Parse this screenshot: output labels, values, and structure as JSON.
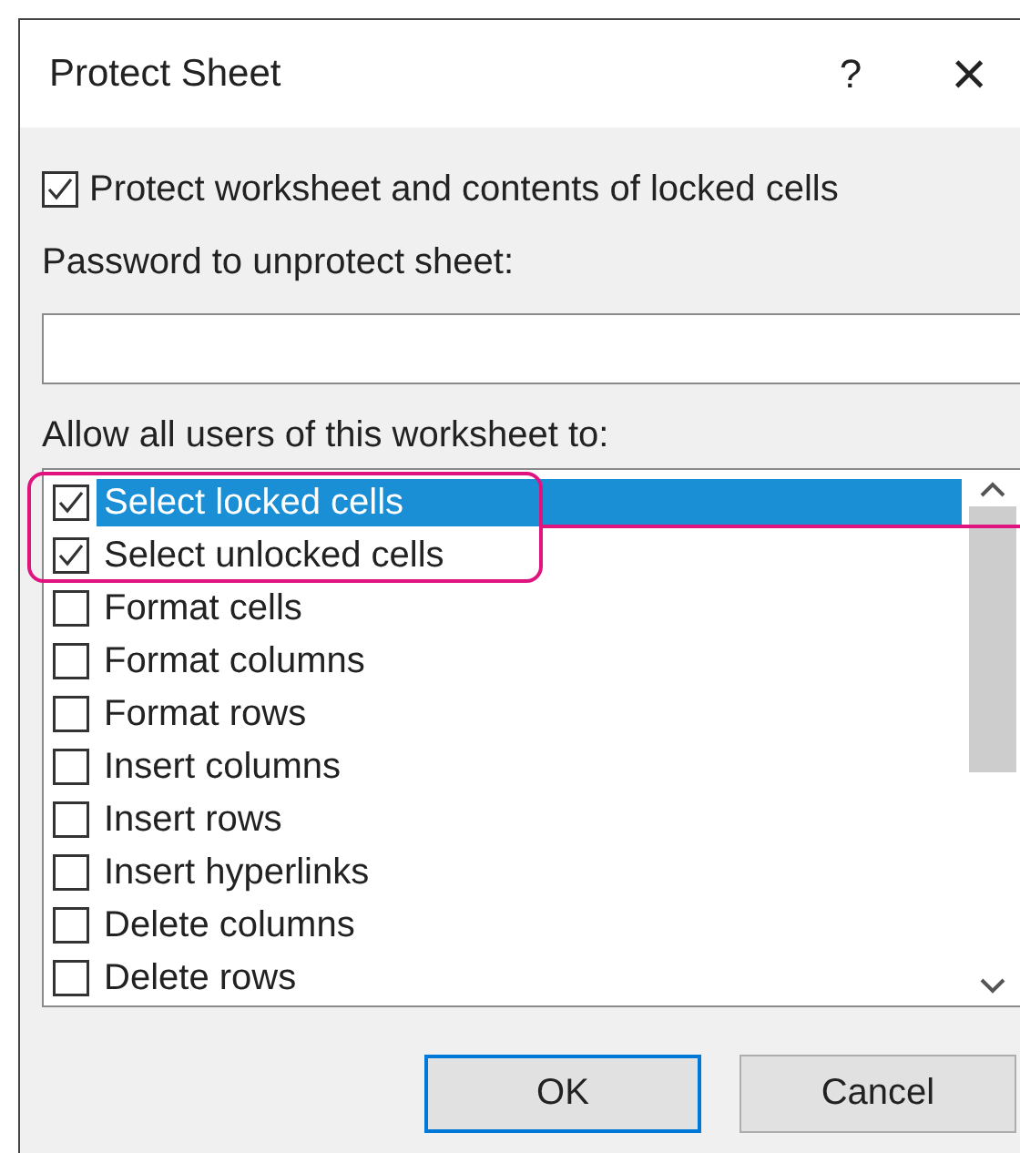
{
  "window": {
    "title": "Protect Sheet",
    "help": "?",
    "close": "×"
  },
  "protect_checkbox": {
    "label": "Protect worksheet and contents of locked cells",
    "checked": true
  },
  "password": {
    "label": "Password to unprotect sheet:"
  },
  "allow_label": "Allow all users of this worksheet to:",
  "permissions": [
    {
      "label": "Select locked cells",
      "checked": true,
      "selected": true
    },
    {
      "label": "Select unlocked cells",
      "checked": true,
      "selected": false
    },
    {
      "label": "Format cells",
      "checked": false,
      "selected": false
    },
    {
      "label": "Format columns",
      "checked": false,
      "selected": false
    },
    {
      "label": "Format rows",
      "checked": false,
      "selected": false
    },
    {
      "label": "Insert columns",
      "checked": false,
      "selected": false
    },
    {
      "label": "Insert rows",
      "checked": false,
      "selected": false
    },
    {
      "label": "Insert hyperlinks",
      "checked": false,
      "selected": false
    },
    {
      "label": "Delete columns",
      "checked": false,
      "selected": false
    },
    {
      "label": "Delete rows",
      "checked": false,
      "selected": false
    }
  ],
  "buttons": [
    {
      "label": "OK",
      "kind": "default"
    },
    {
      "label": "Cancel",
      "kind": "normal"
    }
  ]
}
